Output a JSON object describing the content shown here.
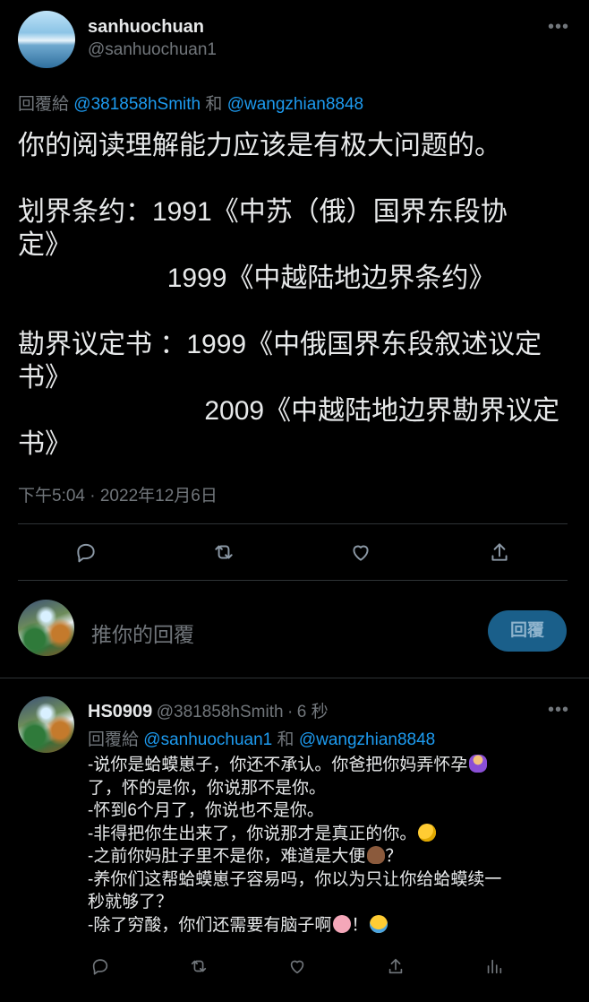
{
  "tweet": {
    "display_name": "sanhuochuan",
    "handle": "@sanhuochuan1",
    "more_icon": "more-horizontal-icon",
    "reply_prefix": "回覆給",
    "reply_user1": "@381858hSmith",
    "reply_and": "和",
    "reply_user2": "@wangzhian8848",
    "text_lines": [
      "你的阅读理解能力应该是有极大问题的。",
      "",
      "划界条约：1991《中苏（俄）国界东段协",
      "定》",
      "                    1999《中越陆地边界条约》",
      "",
      "勘界议定书 ：1999《中俄国界东段叙述议定",
      "书》",
      "                         2009《中越陆地边界勘界议定",
      "书》"
    ],
    "timestamp": "下午5:04 · 2022年12月6日",
    "actions": [
      "reply-icon",
      "retweet-icon",
      "like-icon",
      "share-icon"
    ]
  },
  "compose": {
    "placeholder": "推你的回覆",
    "button_label": "回覆"
  },
  "reply": {
    "display_name": "HS0909",
    "handle": "@381858hSmith",
    "separator": "·",
    "time": "6 秒",
    "reply_prefix": "回覆給",
    "reply_user1": "@sanhuochuan1",
    "reply_and": "和",
    "reply_user2": "@wangzhian8848",
    "text_lines": [
      "-说你是蛤蟆崽子，你还不承认。你爸把你妈弄怀孕",
      "了，怀的是你，你说那不是你。",
      "-怀到6个月了，你说也不是你。",
      "-非得把你生出来了，你说那才是真正的你。",
      "-之前你妈肚子里不是你，难道是大便",
      "-养你们这帮蛤蟆崽子容易吗，你以为只让你给蛤蟆续一",
      "秒就够了？",
      "-除了穷酸，你们还需要有脑子啊"
    ],
    "emoji_suffixes": [
      "pregnant-person-emoji",
      "",
      "",
      "rofl-emoji",
      "poo-emoji ？",
      "",
      "",
      "brain-emoji ！ joy-emoji"
    ],
    "actions": [
      "reply-icon",
      "retweet-icon",
      "like-icon",
      "share-icon",
      "analytics-icon"
    ]
  }
}
